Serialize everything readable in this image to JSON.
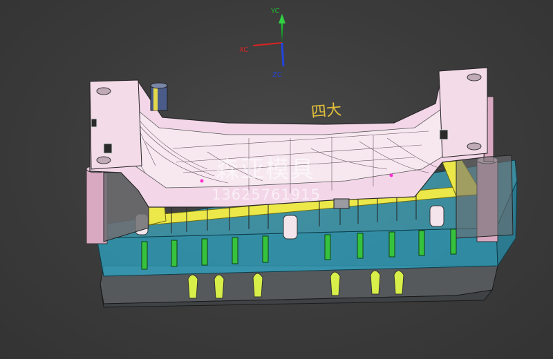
{
  "viewport": {
    "background": "#3b3b3b"
  },
  "triad": {
    "yc_label": "YC",
    "xc_label": "XC",
    "zc_label": "ZC",
    "yc_color": "#22bb33",
    "xc_color": "#dd2222",
    "zc_color": "#2244dd"
  },
  "model": {
    "face_pink": "#f3d7e8",
    "plate_blue": "#37b9d6",
    "frame_yellow": "#e8e84a",
    "pillar_pink": "#d9a9c1",
    "base_grey": "#5a5a5a",
    "text_mark": "四大"
  },
  "watermark": {
    "brand": "森亚模具",
    "phone": "13625761915"
  }
}
